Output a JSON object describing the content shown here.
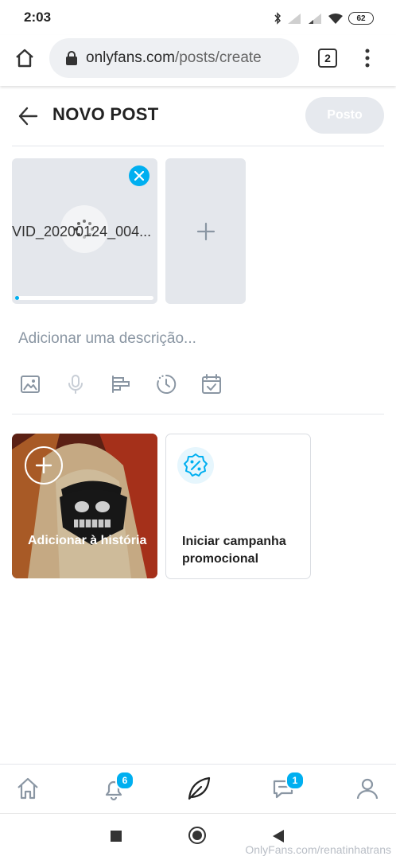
{
  "status_bar": {
    "time": "2:03",
    "battery": "62"
  },
  "browser": {
    "domain": "onlyfans.com",
    "path": "/posts/create",
    "tab_count": "2"
  },
  "header": {
    "title": "NOVO POST",
    "post_button": "Posto"
  },
  "media": {
    "filename": "VID_20200124_004...",
    "upload_progress": 0.03
  },
  "description": {
    "placeholder": "Adicionar uma descrição..."
  },
  "toolbar": [
    "image-icon",
    "microphone-icon",
    "poll-icon",
    "timer-icon",
    "schedule-icon"
  ],
  "cards": {
    "story": "Adicionar à história",
    "promo": "Iniciar campanha promocional"
  },
  "nav": {
    "notifications_badge": "6",
    "messages_badge": "1"
  },
  "watermark": "OnlyFans.com/renatinhatrans",
  "colors": {
    "accent": "#00aff0",
    "muted": "#8a96a3",
    "button_disabled": "#e6e9ee"
  }
}
